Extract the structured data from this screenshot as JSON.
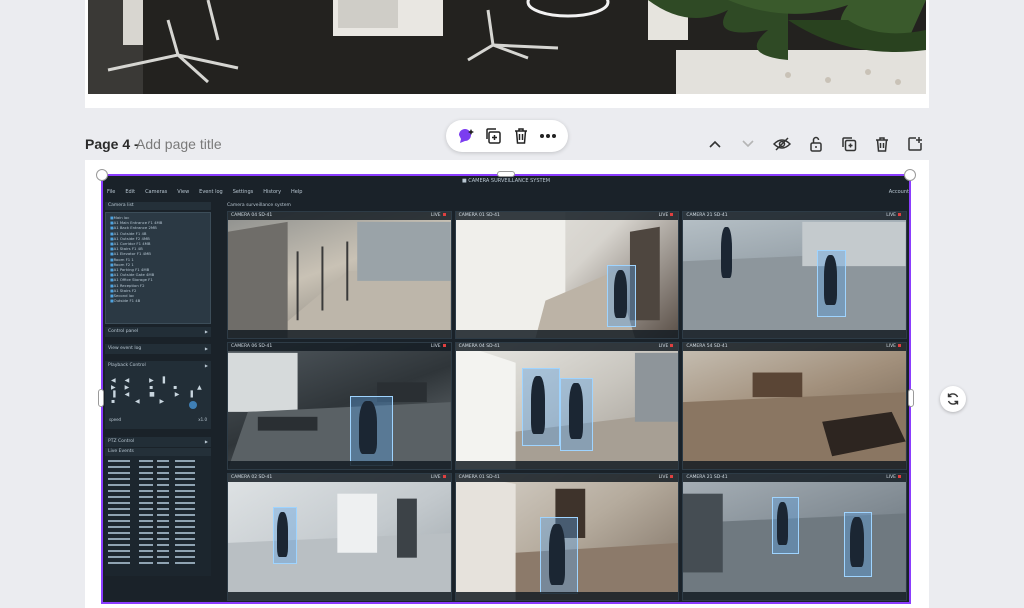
{
  "page4": {
    "page_label": "Page 4 -",
    "title_placeholder": "Add page title"
  },
  "float_toolbar": {
    "icons": [
      "magic-edit-icon",
      "duplicate-icon",
      "trash-icon",
      "more-icon"
    ]
  },
  "page_actions": {
    "icons": [
      "chevron-up-icon",
      "chevron-down-icon",
      "hide-icon",
      "lock-icon",
      "duplicate-page-icon",
      "trash-icon",
      "add-page-icon"
    ]
  },
  "accent_color": "#8b3dff",
  "surveillance_app": {
    "menu": [
      "File",
      "Edit",
      "Cameras",
      "View",
      "Event log",
      "Settings",
      "History",
      "Help",
      "Account"
    ],
    "side_panels": {
      "tree_header": "Camera list",
      "tree_items": [
        "Main loc",
        "A1 Main Entrance F1 4MB",
        "A1 Back Entrance 2MB",
        "A1 Outside F1 4B",
        "A1 Outside F2 4MB",
        "A1 Corridor F1 4MB",
        "A1 Stairs F1 4B",
        "A1 Elevator F1 4MB",
        "Room F1 1",
        "Room F2 1",
        "A1 Parking F1 4MB",
        "A1 Outside Gate 4MB",
        "A1 Office Storage F1",
        "A1 Reception F2",
        "A1 Stairs F2",
        "Second loc",
        "Outside F1 4B"
      ],
      "rows": [
        "Control panel",
        "View event log",
        "Playback Control"
      ],
      "speed_label": "speed",
      "speed_value": "x1.0",
      "ptz_label": "PTZ Control",
      "events_header": "Live Events"
    },
    "grid_title": "Camera surveillance system",
    "cameras": [
      {
        "name": "CAMERA 04 SD-41",
        "live": "LIVE"
      },
      {
        "name": "CAMERA 01 SD-41",
        "live": "LIVE"
      },
      {
        "name": "CAMERA 21 SD-41",
        "live": "LIVE"
      },
      {
        "name": "CAMERA 06 SD-41",
        "live": "LIVE"
      },
      {
        "name": "CAMERA 04 SD-41",
        "live": "LIVE"
      },
      {
        "name": "CAMERA 54 SD-41",
        "live": "LIVE"
      },
      {
        "name": "CAMERA 02 SD-41",
        "live": "LIVE"
      },
      {
        "name": "CAMERA 01 SD-41",
        "live": "LIVE"
      },
      {
        "name": "CAMERA 21 SD-41",
        "live": "LIVE"
      }
    ]
  }
}
